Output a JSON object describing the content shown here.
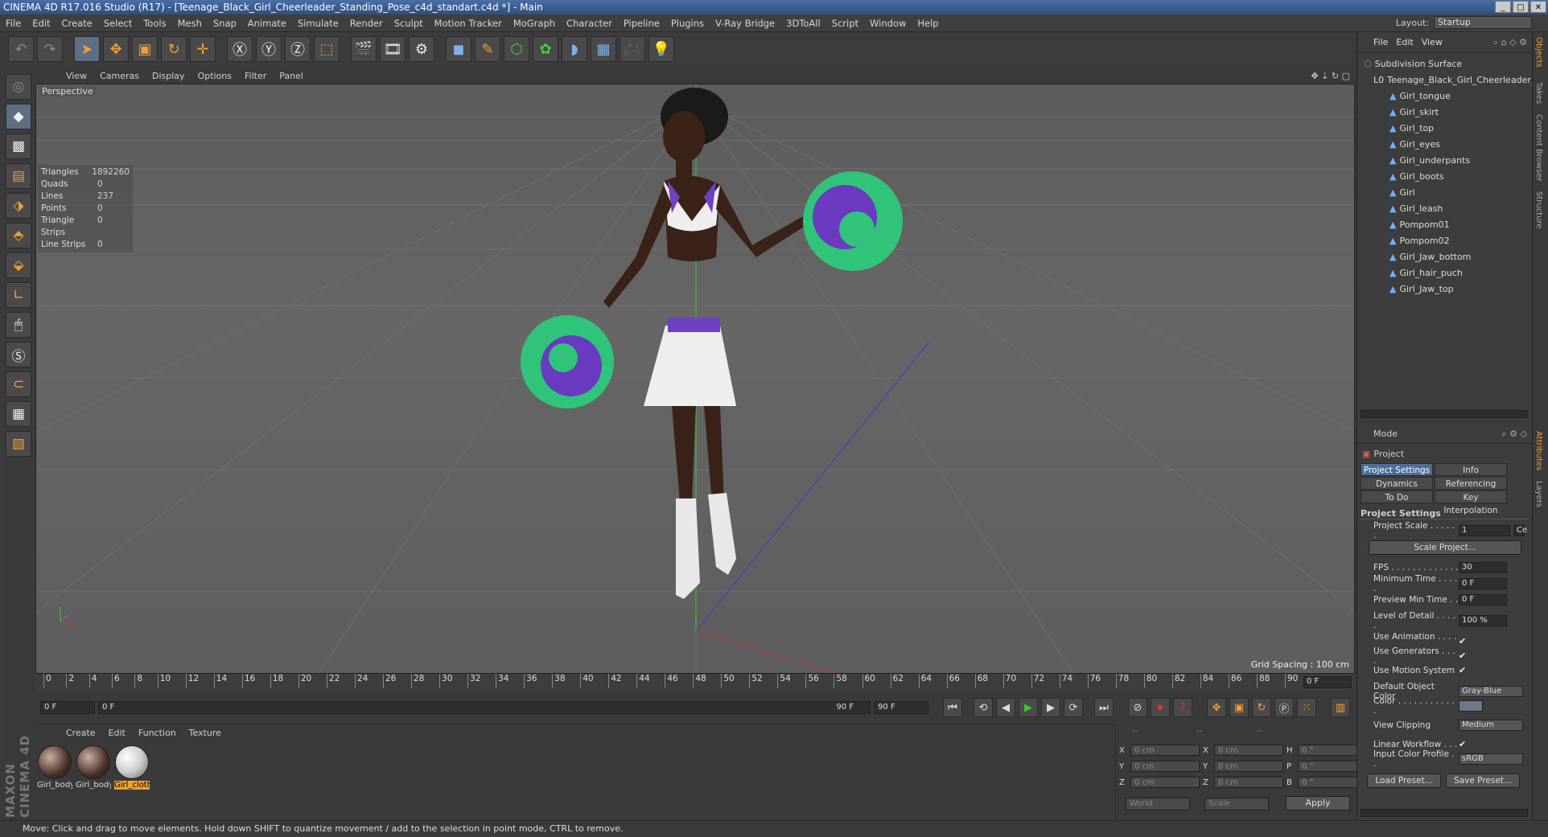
{
  "window": {
    "title": "CINEMA 4D R17.016 Studio (R17) - [Teenage_Black_Girl_Cheerleader_Standing_Pose_c4d_standart.c4d *] - Main"
  },
  "menu": [
    "File",
    "Edit",
    "Create",
    "Select",
    "Tools",
    "Mesh",
    "Snap",
    "Animate",
    "Simulate",
    "Render",
    "Sculpt",
    "Motion Tracker",
    "MoGraph",
    "Character",
    "Pipeline",
    "Plugins",
    "V-Ray Bridge",
    "3DToAll",
    "Script",
    "Window",
    "Help"
  ],
  "layout": {
    "label": "Layout:",
    "value": "Startup"
  },
  "viewport": {
    "menu": [
      "View",
      "Cameras",
      "Display",
      "Options",
      "Filter",
      "Panel"
    ],
    "label": "Perspective",
    "stats": [
      {
        "k": "Triangles",
        "v": "1892260"
      },
      {
        "k": "Quads",
        "v": "0"
      },
      {
        "k": "Lines",
        "v": "237"
      },
      {
        "k": "Points",
        "v": "0"
      },
      {
        "k": "Triangle Strips",
        "v": "0"
      },
      {
        "k": "Line Strips",
        "v": "0"
      }
    ],
    "grid_spacing": "Grid Spacing : 100 cm"
  },
  "timeline": {
    "ticks": [
      "0",
      "2",
      "4",
      "6",
      "8",
      "10",
      "12",
      "14",
      "16",
      "18",
      "20",
      "22",
      "24",
      "26",
      "28",
      "30",
      "32",
      "34",
      "36",
      "38",
      "40",
      "42",
      "44",
      "46",
      "48",
      "50",
      "52",
      "54",
      "56",
      "58",
      "60",
      "62",
      "64",
      "66",
      "68",
      "70",
      "72",
      "74",
      "76",
      "78",
      "80",
      "82",
      "84",
      "86",
      "88",
      "90"
    ],
    "end_frame": "0 F",
    "start": "0 F",
    "range_start": "0 F",
    "range_end": "90 F",
    "end": "90 F"
  },
  "materials": {
    "menu": [
      "Create",
      "Edit",
      "Function",
      "Texture"
    ],
    "items": [
      "Girl_body",
      "Girl_body",
      "Girl_cloth"
    ]
  },
  "coords": {
    "rows": [
      {
        "a": "X",
        "av": "0 cm",
        "b": "X",
        "bv": "0 cm",
        "c": "H",
        "cv": "0 °"
      },
      {
        "a": "Y",
        "av": "0 cm",
        "b": "Y",
        "bv": "0 cm",
        "c": "P",
        "cv": "0 °"
      },
      {
        "a": "Z",
        "av": "0 cm",
        "b": "Z",
        "bv": "0 cm",
        "c": "B",
        "cv": "0 °"
      }
    ],
    "world": "World",
    "scale": "Scale",
    "apply": "Apply"
  },
  "status": "Move: Click and drag to move elements. Hold down SHIFT to quantize movement / add to the selection in point mode, CTRL to remove.",
  "maxon": "MAXON CINEMA 4D",
  "objects": {
    "menu": [
      "File",
      "Edit",
      "View"
    ],
    "root": "Subdivision Surface",
    "group": "Teenage_Black_Girl_Cheerleader_S",
    "children": [
      "Girl_tongue",
      "Girl_skirt",
      "Girl_top",
      "Girl_eyes",
      "Girl_underpants",
      "Girl_boots",
      "Girl",
      "Girl_leash",
      "Pompom01",
      "Pompom02",
      "Girl_Jaw_bottom",
      "Girl_hair_puch",
      "Girl_Jaw_top"
    ]
  },
  "attributes": {
    "mode": "Mode",
    "header": "Project",
    "tabs": [
      "Project Settings",
      "Info",
      "Dynamics",
      "Referencing",
      "To Do",
      "Key Interpolation"
    ],
    "section": "Project Settings",
    "project_scale": {
      "label": "Project Scale . . . . . .",
      "value": "1",
      "unit": "Ce"
    },
    "scale_btn": "Scale Project...",
    "fps": {
      "label": "FPS . . . . . . . . . . . . .",
      "value": "30"
    },
    "min_time": {
      "label": "Minimum Time . . . . .",
      "value": "0 F"
    },
    "preview_min": {
      "label": "Preview Min Time . .",
      "value": "0 F"
    },
    "lod": {
      "label": "Level of Detail . . . . .",
      "value": "100 %"
    },
    "use_anim": "Use Animation . . . . .",
    "use_gen": "Use Generators . . . .",
    "use_motion": "Use Motion System",
    "def_color": {
      "label": "Default Object Color",
      "value": "Gray-Blue"
    },
    "color": "Color . . . . . . . . . . . .",
    "view_clip": {
      "label": "View Clipping",
      "value": "Medium"
    },
    "linear": "Linear Workflow . . .",
    "input_prof": {
      "label": "Input Color Profile . .",
      "value": "sRGB"
    },
    "load": "Load Preset...",
    "save": "Save Preset..."
  },
  "side_tabs": [
    "Objects",
    "Takes",
    "Content Browser",
    "Structure",
    "Attributes",
    "Layers"
  ]
}
